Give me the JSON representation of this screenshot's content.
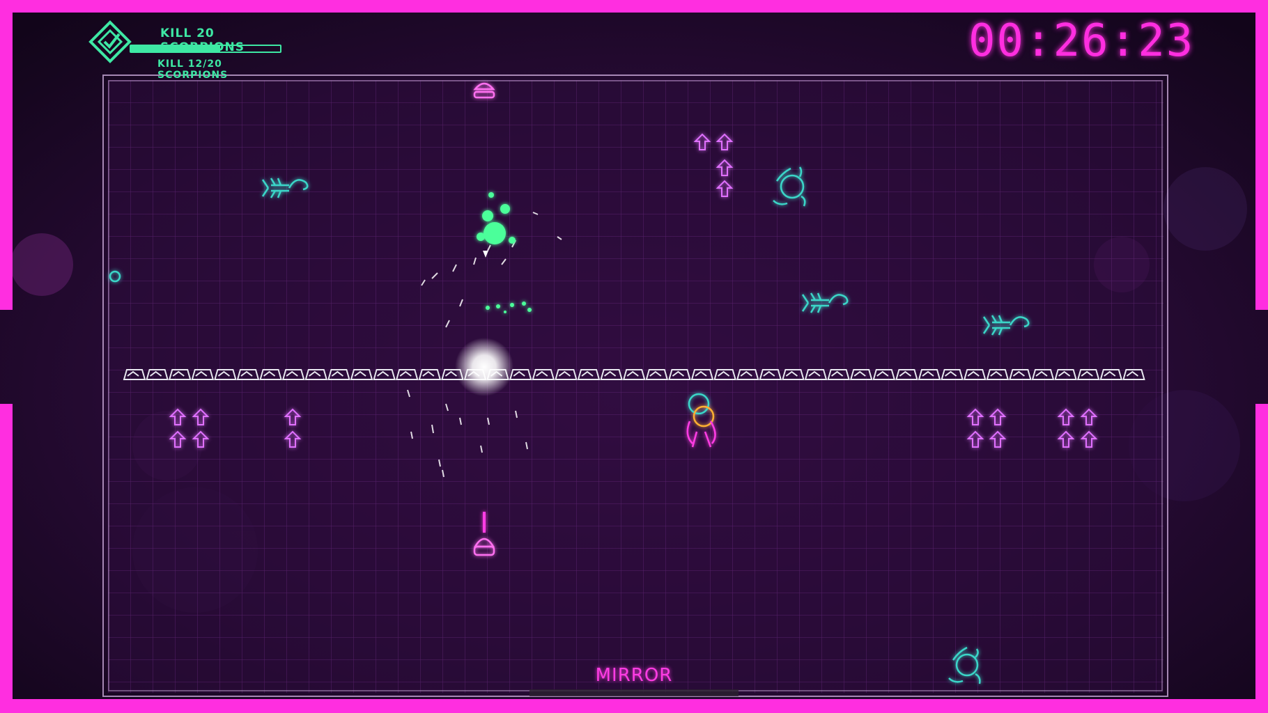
{
  "hud": {
    "objective_title": "KILL 20 SCORPIONS",
    "objective_progress_text": "KILL 12/20 SCORPIONS",
    "objective_progress_fraction": 0.6,
    "timer": "00:26:23",
    "mode": "MIRROR"
  },
  "icons": {
    "objective": "checkmark-diamond-icon"
  },
  "colors": {
    "border": "#ff2ee0",
    "grid": "#5a1f6e",
    "enemy_cyan": "#3ad6c8",
    "objective_green": "#3ee8a4",
    "mushroom": "#e070ff",
    "block": "#e8e8f0"
  }
}
